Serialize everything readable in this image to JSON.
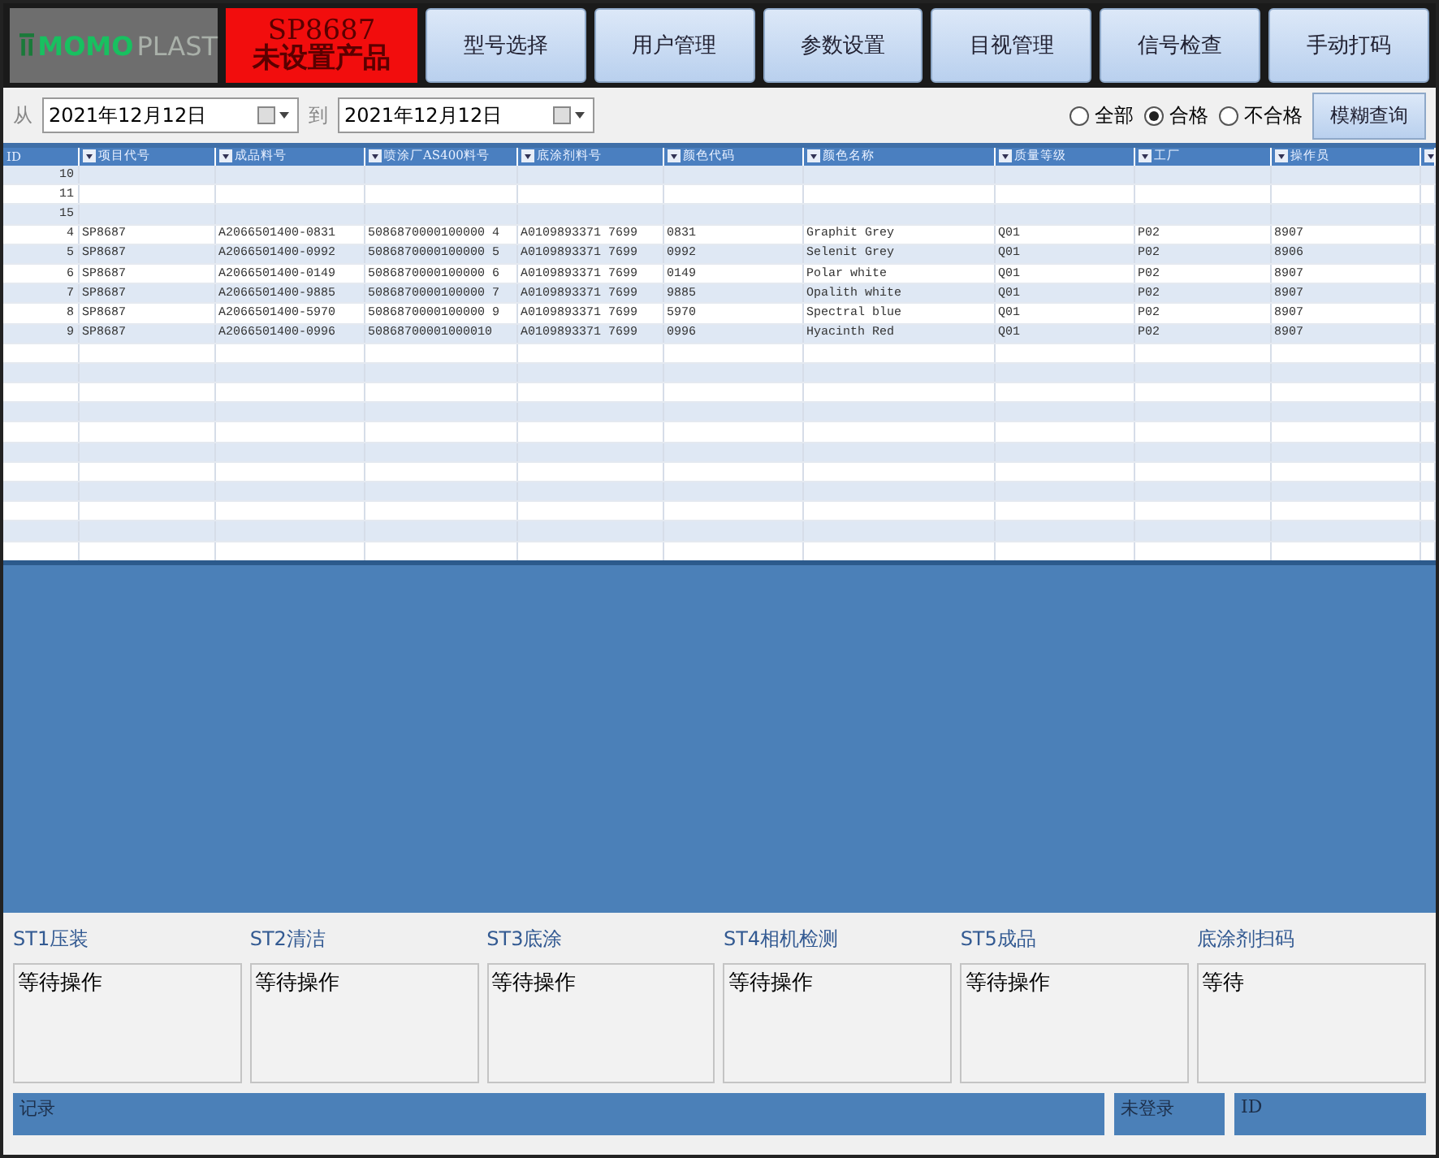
{
  "logo": {
    "text_a": "MOMO",
    "text_b": "PLAST"
  },
  "product_status": {
    "code": "SP8687",
    "message": "未设置产品"
  },
  "nav_buttons": [
    "型号选择",
    "用户管理",
    "参数设置",
    "目视管理",
    "信号检查",
    "手动打码"
  ],
  "date_filter": {
    "from_label": "从",
    "from": "2021年12月12日",
    "to_label": "到",
    "to": "2021年12月12日"
  },
  "result_filter": [
    {
      "label": "全部",
      "selected": false
    },
    {
      "label": "合格",
      "selected": true
    },
    {
      "label": "不合格",
      "selected": false
    }
  ],
  "search_button": "模糊查询",
  "table": {
    "columns": [
      "ID",
      "项目代号",
      "成品料号",
      "喷涂厂AS400料号",
      "底涂剂料号",
      "颜色代码",
      "颜色名称",
      "质量等级",
      "工厂",
      "操作员"
    ],
    "rows": [
      [
        "10",
        "",
        "",
        "",
        "",
        "",
        "",
        "",
        "",
        ""
      ],
      [
        "11",
        "",
        "",
        "",
        "",
        "",
        "",
        "",
        "",
        ""
      ],
      [
        "15",
        "",
        "",
        "",
        "",
        "",
        "",
        "",
        "",
        ""
      ],
      [
        "4",
        "SP8687",
        "A2066501400-0831",
        "5086870000100000 4",
        "A0109893371 7699",
        "0831",
        "Graphit Grey",
        "Q01",
        "P02",
        "8907"
      ],
      [
        "5",
        "SP8687",
        "A2066501400-0992",
        "5086870000100000 5",
        "A0109893371 7699",
        "0992",
        "Selenit Grey",
        "Q01",
        "P02",
        "8906"
      ],
      [
        "6",
        "SP8687",
        "A2066501400-0149",
        "5086870000100000 6",
        "A0109893371 7699",
        "0149",
        "Polar white",
        "Q01",
        "P02",
        "8907"
      ],
      [
        "7",
        "SP8687",
        "A2066501400-9885",
        "5086870000100000 7",
        "A0109893371 7699",
        "9885",
        "Opalith white",
        "Q01",
        "P02",
        "8907"
      ],
      [
        "8",
        "SP8687",
        "A2066501400-5970",
        "5086870000100000 9",
        "A0109893371 7699",
        "5970",
        "Spectral blue",
        "Q01",
        "P02",
        "8907"
      ],
      [
        "9",
        "SP8687",
        "A2066501400-0996",
        "50868700001000010",
        "A0109893371 7699",
        "0996",
        "Hyacinth Red",
        "Q01",
        "P02",
        "8907"
      ]
    ]
  },
  "stations": [
    {
      "name": "ST1压装",
      "status": "等待操作"
    },
    {
      "name": "ST2清洁",
      "status": "等待操作"
    },
    {
      "name": "ST3底涂",
      "status": "等待操作"
    },
    {
      "name": "ST4相机检测",
      "status": "等待操作"
    },
    {
      "name": "ST5成品",
      "status": "等待操作"
    },
    {
      "name": "底涂剂扫码",
      "status": "等待"
    }
  ],
  "status_bar": {
    "log_label": "记录",
    "user": "未登录",
    "id_label": "ID"
  }
}
